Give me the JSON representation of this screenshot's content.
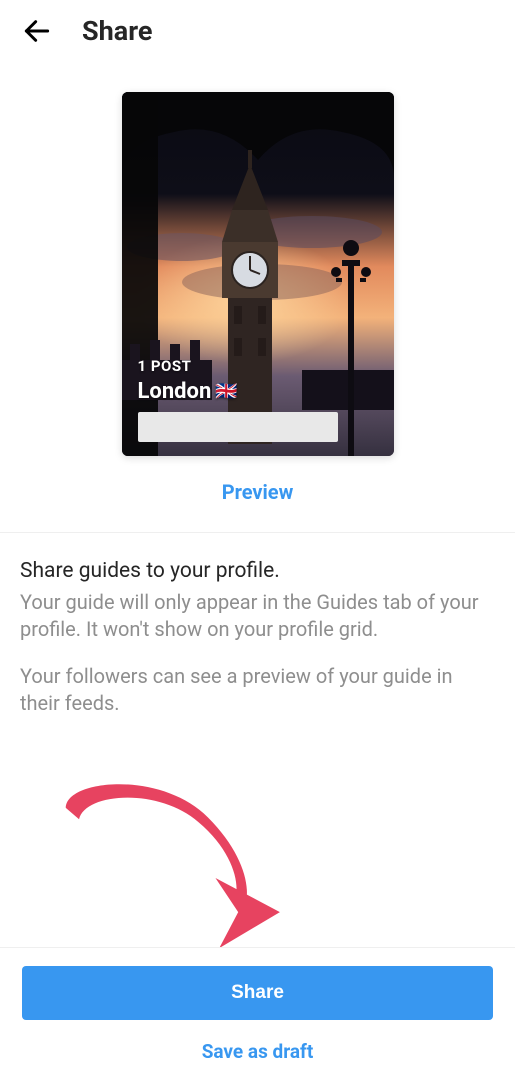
{
  "header": {
    "title": "Share"
  },
  "cover": {
    "post_count": "1 POST",
    "title": "London",
    "flag": "🇬🇧"
  },
  "preview_link": "Preview",
  "info": {
    "heading": "Share guides to your profile.",
    "body1": "Your guide will only appear in the Guides tab of your profile. It won't show on your profile grid.",
    "body2": "Your followers can see a preview of your guide in their feeds."
  },
  "actions": {
    "share": "Share",
    "save_draft": "Save as draft"
  },
  "colors": {
    "accent": "#3897f0",
    "annotation": "#e74360"
  }
}
